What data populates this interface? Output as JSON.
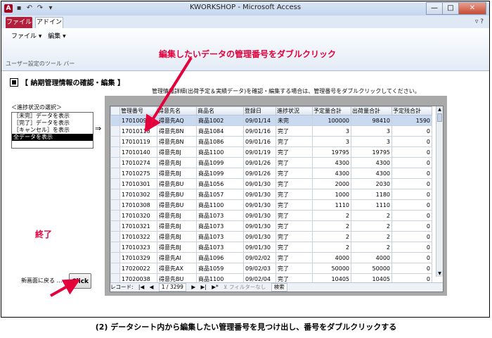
{
  "window": {
    "title": "KWORKSHOP - Microsoft Access",
    "buttons": {
      "minimize": "—",
      "maximize": "□",
      "close": "✕"
    }
  },
  "ribbon": {
    "tabs": [
      "ファイル",
      "アドイン"
    ],
    "menu": [
      "ファイル ▾",
      "編集 ▾"
    ],
    "group_label": "ユーザー設定のツール バー",
    "right_icons": "▿ ?"
  },
  "annotations": {
    "top": "編集したいデータの管理番号をダブルクリック",
    "end": "終了"
  },
  "form": {
    "heading": "【 納期管理情報の確認・編集 】",
    "instruction": "管理情報詳細(出荷予定＆実績データ)を確認・編集する場合は、管理番号をダブルクリックしてください。",
    "filter_label": "＜進捗状況の選択＞",
    "filter_options": [
      {
        "label": "［未完］データを表示",
        "selected": false
      },
      {
        "label": "［完了］データを表示",
        "selected": false
      },
      {
        "label": "［キャンセル］を表示",
        "selected": false
      },
      {
        "label": "全データを表示",
        "selected": true
      }
    ],
    "arrow": "⇒",
    "back_label": "新画面に戻る ……",
    "click_button": "Click"
  },
  "datasheet": {
    "columns": [
      "管理番号",
      "得意先名",
      "商品名",
      "登録日",
      "進捗状況",
      "予定量合計",
      "出荷量合計",
      "予定残合計"
    ],
    "rows": [
      [
        "17010090",
        "得意先AQ",
        "商品1002",
        "09/01/14",
        "未完",
        "100000",
        "98410",
        "1590"
      ],
      [
        "17010118",
        "得意先BN",
        "商品1084",
        "09/01/16",
        "完了",
        "3",
        "3",
        "0"
      ],
      [
        "17010119",
        "得意先BN",
        "商品1086",
        "09/01/16",
        "完了",
        "3",
        "3",
        "0"
      ],
      [
        "17010140",
        "得意先BJ",
        "商品1100",
        "09/01/19",
        "完了",
        "19795",
        "19795",
        "0"
      ],
      [
        "17010274",
        "得意先BJ",
        "商品1099",
        "09/01/26",
        "完了",
        "4300",
        "4300",
        "0"
      ],
      [
        "17010275",
        "得意先BJ",
        "商品1099",
        "09/01/26",
        "完了",
        "4300",
        "4300",
        "0"
      ],
      [
        "17010301",
        "得意先BU",
        "商品1056",
        "09/01/30",
        "完了",
        "2000",
        "2030",
        "0"
      ],
      [
        "17010302",
        "得意先BU",
        "商品1057",
        "09/01/30",
        "完了",
        "1000",
        "1180",
        "0"
      ],
      [
        "17010308",
        "得意先BU",
        "商品1100",
        "09/01/30",
        "完了",
        "1110",
        "1110",
        "0"
      ],
      [
        "17010320",
        "得意先BJ",
        "商品1073",
        "09/01/30",
        "完了",
        "2",
        "2",
        "0"
      ],
      [
        "17010321",
        "得意先BJ",
        "商品1073",
        "09/01/30",
        "完了",
        "2",
        "2",
        "0"
      ],
      [
        "17010322",
        "得意先BJ",
        "商品1073",
        "09/01/30",
        "完了",
        "2",
        "2",
        "0"
      ],
      [
        "17010323",
        "得意先BJ",
        "商品1073",
        "09/01/30",
        "完了",
        "2",
        "2",
        "0"
      ],
      [
        "17010329",
        "得意先AI",
        "商品1096",
        "09/02/02",
        "完了",
        "4000",
        "4000",
        "0"
      ],
      [
        "17020022",
        "得意先AX",
        "商品1059",
        "09/02/03",
        "完了",
        "50000",
        "50000",
        "0"
      ],
      [
        "17020038",
        "得意先BU",
        "商品1100",
        "09/02/04",
        "完了",
        "10405",
        "10405",
        "0"
      ]
    ],
    "navbar": {
      "label": "レコード:",
      "first": "|◀",
      "prev": "◀",
      "position": "1 / 3299",
      "next": "▶",
      "last": "▶|",
      "new": "▶*",
      "filter": "⊻ フィルターなし",
      "search": "検索"
    }
  },
  "caption": "(2) データシート内から編集したい管理番号を見つけ出し、番号をダブルクリックする",
  "colors": {
    "annotation": "#e4003b",
    "file_tab": "#b2213c",
    "selected_row": "#c9d9f0",
    "panel": "#a9a9a9"
  }
}
